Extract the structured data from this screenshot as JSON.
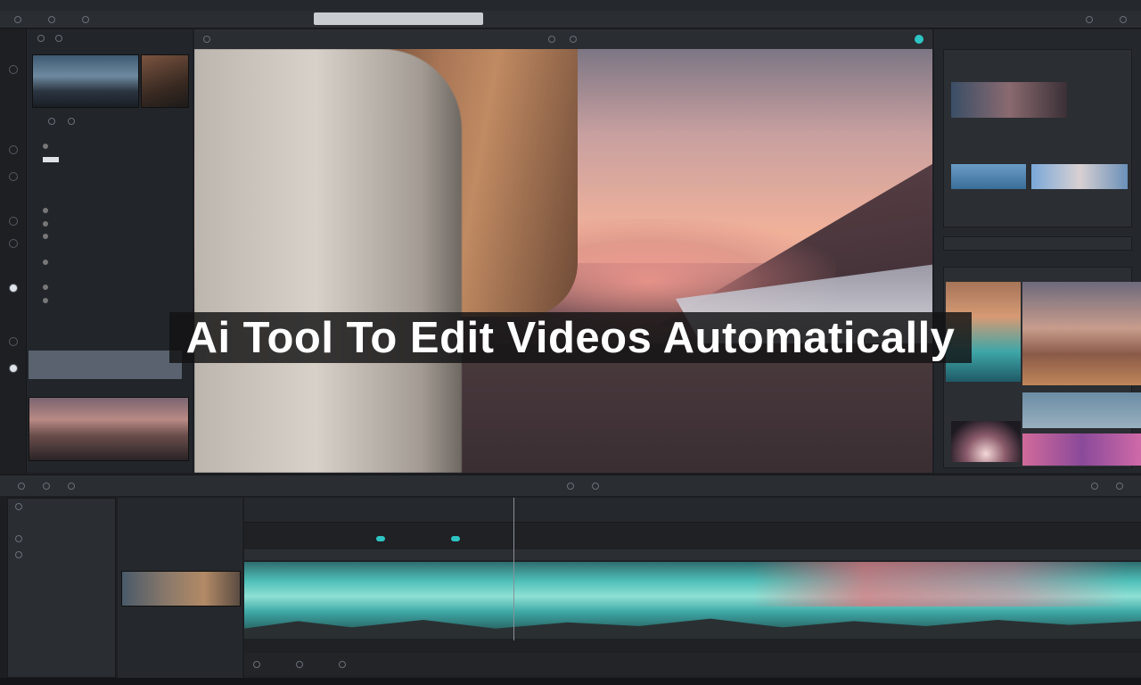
{
  "title": {
    "text": "Ai Tool To Edit Videos Automatically"
  },
  "colors": {
    "accent": "#2ec4c4",
    "banner_bg": "#121214",
    "banner_text": "#ffffff"
  },
  "icons": {
    "rail": [
      "circle-icon",
      "circle-icon",
      "circle-icon",
      "circle-icon",
      "circle-icon",
      "circle-icon",
      "circle-icon",
      "circle-icon"
    ],
    "viewer_status": "teal-dot-icon"
  },
  "progress": {
    "playhead_fraction": 0.3
  }
}
